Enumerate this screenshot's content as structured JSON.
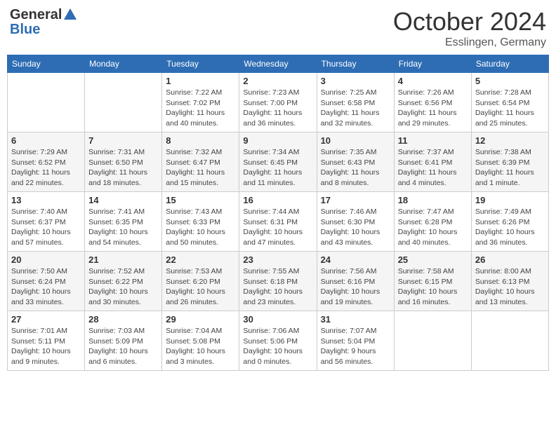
{
  "header": {
    "logo_general": "General",
    "logo_blue": "Blue",
    "month": "October 2024",
    "location": "Esslingen, Germany"
  },
  "days_of_week": [
    "Sunday",
    "Monday",
    "Tuesday",
    "Wednesday",
    "Thursday",
    "Friday",
    "Saturday"
  ],
  "weeks": [
    [
      {
        "day": "",
        "sunrise": "",
        "sunset": "",
        "daylight": ""
      },
      {
        "day": "",
        "sunrise": "",
        "sunset": "",
        "daylight": ""
      },
      {
        "day": "1",
        "sunrise": "Sunrise: 7:22 AM",
        "sunset": "Sunset: 7:02 PM",
        "daylight": "Daylight: 11 hours and 40 minutes."
      },
      {
        "day": "2",
        "sunrise": "Sunrise: 7:23 AM",
        "sunset": "Sunset: 7:00 PM",
        "daylight": "Daylight: 11 hours and 36 minutes."
      },
      {
        "day": "3",
        "sunrise": "Sunrise: 7:25 AM",
        "sunset": "Sunset: 6:58 PM",
        "daylight": "Daylight: 11 hours and 32 minutes."
      },
      {
        "day": "4",
        "sunrise": "Sunrise: 7:26 AM",
        "sunset": "Sunset: 6:56 PM",
        "daylight": "Daylight: 11 hours and 29 minutes."
      },
      {
        "day": "5",
        "sunrise": "Sunrise: 7:28 AM",
        "sunset": "Sunset: 6:54 PM",
        "daylight": "Daylight: 11 hours and 25 minutes."
      }
    ],
    [
      {
        "day": "6",
        "sunrise": "Sunrise: 7:29 AM",
        "sunset": "Sunset: 6:52 PM",
        "daylight": "Daylight: 11 hours and 22 minutes."
      },
      {
        "day": "7",
        "sunrise": "Sunrise: 7:31 AM",
        "sunset": "Sunset: 6:50 PM",
        "daylight": "Daylight: 11 hours and 18 minutes."
      },
      {
        "day": "8",
        "sunrise": "Sunrise: 7:32 AM",
        "sunset": "Sunset: 6:47 PM",
        "daylight": "Daylight: 11 hours and 15 minutes."
      },
      {
        "day": "9",
        "sunrise": "Sunrise: 7:34 AM",
        "sunset": "Sunset: 6:45 PM",
        "daylight": "Daylight: 11 hours and 11 minutes."
      },
      {
        "day": "10",
        "sunrise": "Sunrise: 7:35 AM",
        "sunset": "Sunset: 6:43 PM",
        "daylight": "Daylight: 11 hours and 8 minutes."
      },
      {
        "day": "11",
        "sunrise": "Sunrise: 7:37 AM",
        "sunset": "Sunset: 6:41 PM",
        "daylight": "Daylight: 11 hours and 4 minutes."
      },
      {
        "day": "12",
        "sunrise": "Sunrise: 7:38 AM",
        "sunset": "Sunset: 6:39 PM",
        "daylight": "Daylight: 11 hours and 1 minute."
      }
    ],
    [
      {
        "day": "13",
        "sunrise": "Sunrise: 7:40 AM",
        "sunset": "Sunset: 6:37 PM",
        "daylight": "Daylight: 10 hours and 57 minutes."
      },
      {
        "day": "14",
        "sunrise": "Sunrise: 7:41 AM",
        "sunset": "Sunset: 6:35 PM",
        "daylight": "Daylight: 10 hours and 54 minutes."
      },
      {
        "day": "15",
        "sunrise": "Sunrise: 7:43 AM",
        "sunset": "Sunset: 6:33 PM",
        "daylight": "Daylight: 10 hours and 50 minutes."
      },
      {
        "day": "16",
        "sunrise": "Sunrise: 7:44 AM",
        "sunset": "Sunset: 6:31 PM",
        "daylight": "Daylight: 10 hours and 47 minutes."
      },
      {
        "day": "17",
        "sunrise": "Sunrise: 7:46 AM",
        "sunset": "Sunset: 6:30 PM",
        "daylight": "Daylight: 10 hours and 43 minutes."
      },
      {
        "day": "18",
        "sunrise": "Sunrise: 7:47 AM",
        "sunset": "Sunset: 6:28 PM",
        "daylight": "Daylight: 10 hours and 40 minutes."
      },
      {
        "day": "19",
        "sunrise": "Sunrise: 7:49 AM",
        "sunset": "Sunset: 6:26 PM",
        "daylight": "Daylight: 10 hours and 36 minutes."
      }
    ],
    [
      {
        "day": "20",
        "sunrise": "Sunrise: 7:50 AM",
        "sunset": "Sunset: 6:24 PM",
        "daylight": "Daylight: 10 hours and 33 minutes."
      },
      {
        "day": "21",
        "sunrise": "Sunrise: 7:52 AM",
        "sunset": "Sunset: 6:22 PM",
        "daylight": "Daylight: 10 hours and 30 minutes."
      },
      {
        "day": "22",
        "sunrise": "Sunrise: 7:53 AM",
        "sunset": "Sunset: 6:20 PM",
        "daylight": "Daylight: 10 hours and 26 minutes."
      },
      {
        "day": "23",
        "sunrise": "Sunrise: 7:55 AM",
        "sunset": "Sunset: 6:18 PM",
        "daylight": "Daylight: 10 hours and 23 minutes."
      },
      {
        "day": "24",
        "sunrise": "Sunrise: 7:56 AM",
        "sunset": "Sunset: 6:16 PM",
        "daylight": "Daylight: 10 hours and 19 minutes."
      },
      {
        "day": "25",
        "sunrise": "Sunrise: 7:58 AM",
        "sunset": "Sunset: 6:15 PM",
        "daylight": "Daylight: 10 hours and 16 minutes."
      },
      {
        "day": "26",
        "sunrise": "Sunrise: 8:00 AM",
        "sunset": "Sunset: 6:13 PM",
        "daylight": "Daylight: 10 hours and 13 minutes."
      }
    ],
    [
      {
        "day": "27",
        "sunrise": "Sunrise: 7:01 AM",
        "sunset": "Sunset: 5:11 PM",
        "daylight": "Daylight: 10 hours and 9 minutes."
      },
      {
        "day": "28",
        "sunrise": "Sunrise: 7:03 AM",
        "sunset": "Sunset: 5:09 PM",
        "daylight": "Daylight: 10 hours and 6 minutes."
      },
      {
        "day": "29",
        "sunrise": "Sunrise: 7:04 AM",
        "sunset": "Sunset: 5:08 PM",
        "daylight": "Daylight: 10 hours and 3 minutes."
      },
      {
        "day": "30",
        "sunrise": "Sunrise: 7:06 AM",
        "sunset": "Sunset: 5:06 PM",
        "daylight": "Daylight: 10 hours and 0 minutes."
      },
      {
        "day": "31",
        "sunrise": "Sunrise: 7:07 AM",
        "sunset": "Sunset: 5:04 PM",
        "daylight": "Daylight: 9 hours and 56 minutes."
      },
      {
        "day": "",
        "sunrise": "",
        "sunset": "",
        "daylight": ""
      },
      {
        "day": "",
        "sunrise": "",
        "sunset": "",
        "daylight": ""
      }
    ]
  ]
}
